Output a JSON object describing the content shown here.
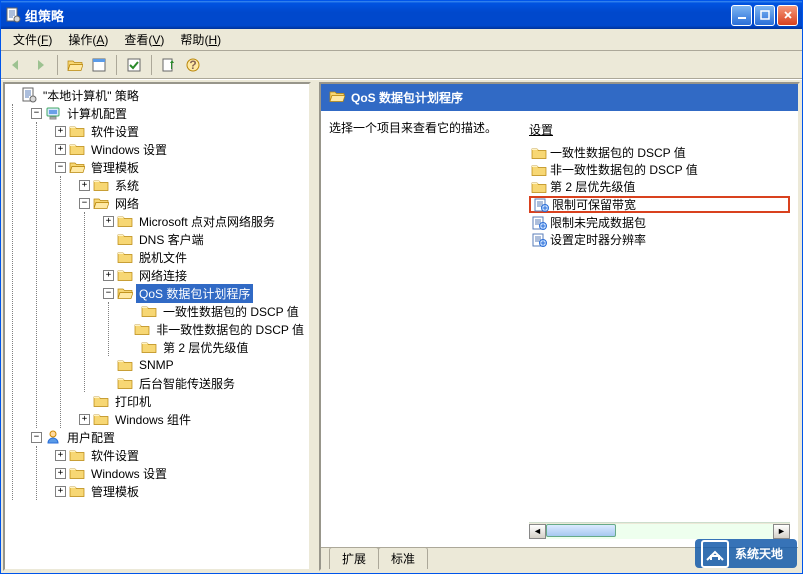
{
  "window": {
    "title": "组策略"
  },
  "menu": {
    "file": {
      "label": "文件",
      "accel": "F"
    },
    "action": {
      "label": "操作",
      "accel": "A"
    },
    "view": {
      "label": "查看",
      "accel": "V"
    },
    "help": {
      "label": "帮助",
      "accel": "H"
    }
  },
  "tree": {
    "root": "\"本地计算机\" 策略",
    "computer_config": "计算机配置",
    "software_settings": "软件设置",
    "windows_settings": "Windows 设置",
    "admin_templates": "管理模板",
    "system": "系统",
    "network": "网络",
    "ms_p2p": "Microsoft 点对点网络服务",
    "dns_client": "DNS 客户端",
    "offline_files": "脱机文件",
    "network_conn": "网络连接",
    "qos": "QoS 数据包计划程序",
    "dscp_conforming": "一致性数据包的 DSCP 值",
    "dscp_nonconforming": "非一致性数据包的 DSCP 值",
    "layer2_priority": "第 2 层优先级值",
    "snmp": "SNMP",
    "bits": "后台智能传送服务",
    "printers": "打印机",
    "windows_components": "Windows 组件",
    "user_config": "用户配置",
    "u_software_settings": "软件设置",
    "u_windows_settings": "Windows 设置",
    "u_admin_templates": "管理模板"
  },
  "right": {
    "header": "QoS 数据包计划程序",
    "desc": "选择一个项目来查看它的描述。",
    "column": "设置",
    "items": [
      {
        "type": "folder",
        "label": "一致性数据包的 DSCP 值"
      },
      {
        "type": "folder",
        "label": "非一致性数据包的 DSCP 值"
      },
      {
        "type": "folder",
        "label": "第 2 层优先级值"
      },
      {
        "type": "setting",
        "label": "限制可保留带宽",
        "highlight": true
      },
      {
        "type": "setting",
        "label": "限制未完成数据包"
      },
      {
        "type": "setting",
        "label": "设置定时器分辨率"
      }
    ]
  },
  "tabs": {
    "extended": "扩展",
    "standard": "标准"
  },
  "watermark": "系统天地"
}
